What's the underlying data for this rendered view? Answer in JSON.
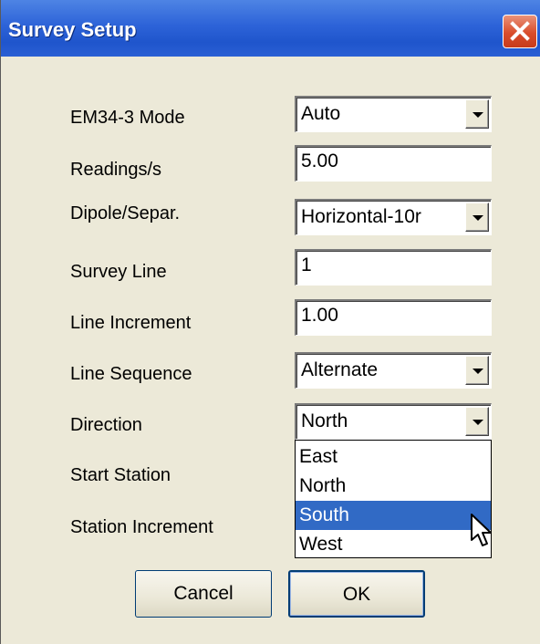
{
  "window": {
    "title": "Survey Setup"
  },
  "fields": {
    "em34_mode": {
      "label": "EM34-3 Mode",
      "value": "Auto"
    },
    "readings": {
      "label": "Readings/s",
      "value": "5.00"
    },
    "dipole": {
      "label": "Dipole/Separ.",
      "value": "Horizontal-10r"
    },
    "survey_line": {
      "label": "Survey Line",
      "value": "1"
    },
    "line_increment": {
      "label": "Line Increment",
      "value": "1.00"
    },
    "line_sequence": {
      "label": "Line Sequence",
      "value": "Alternate"
    },
    "direction": {
      "label": "Direction",
      "value": "North"
    },
    "start_station": {
      "label": "Start Station"
    },
    "station_increment": {
      "label": "Station Increment"
    }
  },
  "direction_options": [
    "East",
    "North",
    "South",
    "West"
  ],
  "direction_highlighted": "South",
  "buttons": {
    "cancel": "Cancel",
    "ok": "OK"
  },
  "icons": {
    "close": "close-icon",
    "dropdown": "chevron-down-icon",
    "cursor": "mouse-pointer-icon"
  },
  "colors": {
    "title_bar": "#2d63d8",
    "close_button": "#d94d2b",
    "dialog_background": "#ece9d8",
    "selection_highlight": "#316ac5"
  }
}
